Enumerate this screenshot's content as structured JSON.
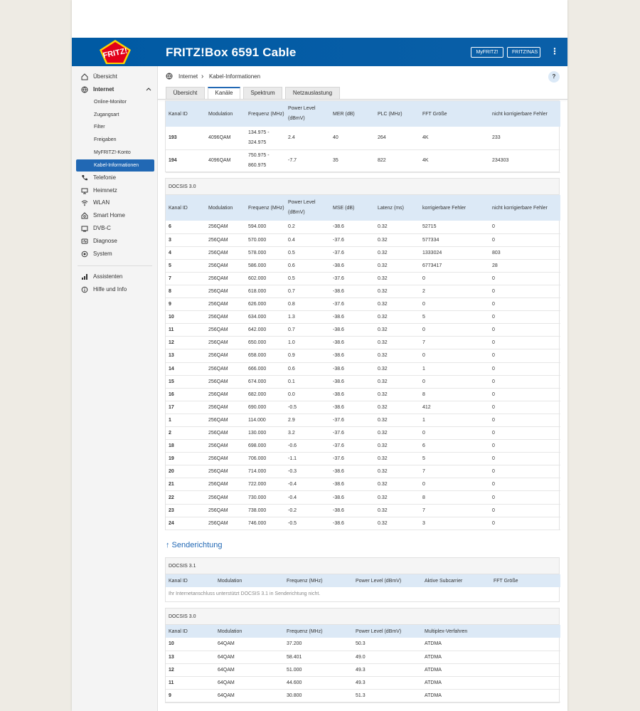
{
  "header": {
    "product": "FRITZ!Box 6591 Cable",
    "logo_text": "FRITZ!",
    "btn_myfritz": "MyFRITZ!",
    "btn_fritznas": "FRITZ!NAS",
    "menu_glyph": "⋮"
  },
  "sidebar": {
    "items": [
      {
        "label": "Übersicht",
        "icon": "home-icon"
      },
      {
        "label": "Internet",
        "icon": "globe-icon"
      },
      {
        "label": "Telefonie",
        "icon": "phone-icon"
      },
      {
        "label": "Heimnetz",
        "icon": "network-icon"
      },
      {
        "label": "WLAN",
        "icon": "wifi-icon"
      },
      {
        "label": "Smart Home",
        "icon": "smarthome-icon"
      },
      {
        "label": "DVB-C",
        "icon": "tv-icon"
      },
      {
        "label": "Diagnose",
        "icon": "diagnose-icon"
      },
      {
        "label": "System",
        "icon": "system-icon"
      },
      {
        "label": "Assistenten",
        "icon": "wizard-icon"
      },
      {
        "label": "Hilfe und Info",
        "icon": "help-icon"
      }
    ],
    "internet_sub": [
      "Online-Monitor",
      "Zugangsart",
      "Filter",
      "Freigaben",
      "MyFRITZ!-Konto",
      "Kabel-Informationen"
    ]
  },
  "breadcrumb": {
    "root": "Internet",
    "sep": "›",
    "current": "Kabel-Informationen"
  },
  "help_label": "?",
  "tabs": [
    "Übersicht",
    "Kanäle",
    "Spektrum",
    "Netzauslastung"
  ],
  "down31": {
    "headers": [
      "Kanal ID",
      "Modulation",
      "Frequenz (MHz)",
      "Power Level (dBmV)",
      "MER (dB)",
      "PLC (MHz)",
      "FFT Größe",
      "nicht korrigierbare Fehler"
    ],
    "rows": [
      [
        "193",
        "4096QAM",
        "134.975 - 324.975",
        "2.4",
        "40",
        "264",
        "4K",
        "233"
      ],
      [
        "194",
        "4096QAM",
        "750.975 - 860.975",
        "-7.7",
        "35",
        "822",
        "4K",
        "234303"
      ]
    ]
  },
  "down30": {
    "title": "DOCSIS 3.0",
    "headers": [
      "Kanal ID",
      "Modulation",
      "Frequenz (MHz)",
      "Power Level (dBmV)",
      "MSE (dB)",
      "Latenz (ms)",
      "korrigierbare Fehler",
      "nicht korrigierbare Fehler"
    ],
    "rows": [
      [
        "6",
        "256QAM",
        "594.000",
        "0.2",
        "-38.6",
        "0.32",
        "52715",
        "0"
      ],
      [
        "3",
        "256QAM",
        "570.000",
        "0.4",
        "-37.6",
        "0.32",
        "577334",
        "0"
      ],
      [
        "4",
        "256QAM",
        "578.000",
        "0.5",
        "-37.6",
        "0.32",
        "1333024",
        "803"
      ],
      [
        "5",
        "256QAM",
        "586.000",
        "0.6",
        "-38.6",
        "0.32",
        "6773417",
        "28"
      ],
      [
        "7",
        "256QAM",
        "602.000",
        "0.5",
        "-37.6",
        "0.32",
        "0",
        "0"
      ],
      [
        "8",
        "256QAM",
        "618.000",
        "0.7",
        "-38.6",
        "0.32",
        "2",
        "0"
      ],
      [
        "9",
        "256QAM",
        "626.000",
        "0.8",
        "-37.6",
        "0.32",
        "0",
        "0"
      ],
      [
        "10",
        "256QAM",
        "634.000",
        "1.3",
        "-38.6",
        "0.32",
        "5",
        "0"
      ],
      [
        "11",
        "256QAM",
        "642.000",
        "0.7",
        "-38.6",
        "0.32",
        "0",
        "0"
      ],
      [
        "12",
        "256QAM",
        "650.000",
        "1.0",
        "-38.6",
        "0.32",
        "7",
        "0"
      ],
      [
        "13",
        "256QAM",
        "658.000",
        "0.9",
        "-38.6",
        "0.32",
        "0",
        "0"
      ],
      [
        "14",
        "256QAM",
        "666.000",
        "0.6",
        "-38.6",
        "0.32",
        "1",
        "0"
      ],
      [
        "15",
        "256QAM",
        "674.000",
        "0.1",
        "-38.6",
        "0.32",
        "0",
        "0"
      ],
      [
        "16",
        "256QAM",
        "682.000",
        "0.0",
        "-38.6",
        "0.32",
        "8",
        "0"
      ],
      [
        "17",
        "256QAM",
        "690.000",
        "-0.5",
        "-38.6",
        "0.32",
        "412",
        "0"
      ],
      [
        "1",
        "256QAM",
        "114.000",
        "2.9",
        "-37.6",
        "0.32",
        "1",
        "0"
      ],
      [
        "2",
        "256QAM",
        "130.000",
        "3.2",
        "-37.6",
        "0.32",
        "0",
        "0"
      ],
      [
        "18",
        "256QAM",
        "698.000",
        "-0.6",
        "-37.6",
        "0.32",
        "6",
        "0"
      ],
      [
        "19",
        "256QAM",
        "706.000",
        "-1.1",
        "-37.6",
        "0.32",
        "5",
        "0"
      ],
      [
        "20",
        "256QAM",
        "714.000",
        "-0.3",
        "-38.6",
        "0.32",
        "7",
        "0"
      ],
      [
        "21",
        "256QAM",
        "722.000",
        "-0.4",
        "-38.6",
        "0.32",
        "0",
        "0"
      ],
      [
        "22",
        "256QAM",
        "730.000",
        "-0.4",
        "-38.6",
        "0.32",
        "8",
        "0"
      ],
      [
        "23",
        "256QAM",
        "738.000",
        "-0.2",
        "-38.6",
        "0.32",
        "7",
        "0"
      ],
      [
        "24",
        "256QAM",
        "746.000",
        "-0.5",
        "-38.6",
        "0.32",
        "3",
        "0"
      ]
    ]
  },
  "upstream_heading": "↑ Senderichtung",
  "up31": {
    "title": "DOCSIS 3.1",
    "headers": [
      "Kanal ID",
      "Modulation",
      "Frequenz (MHz)",
      "Power Level (dBmV)",
      "Aktive Subcarrier",
      "FFT Größe"
    ],
    "note": "Ihr Internetanschluss unterstützt DOCSIS 3.1 in Senderichtung nicht."
  },
  "up30": {
    "title": "DOCSIS 3.0",
    "headers": [
      "Kanal ID",
      "Modulation",
      "Frequenz (MHz)",
      "Power Level (dBmV)",
      "Multiplex-Verfahren"
    ],
    "rows": [
      [
        "10",
        "64QAM",
        "37.200",
        "50.3",
        "ATDMA"
      ],
      [
        "13",
        "64QAM",
        "58.401",
        "49.0",
        "ATDMA"
      ],
      [
        "12",
        "64QAM",
        "51.000",
        "49.3",
        "ATDMA"
      ],
      [
        "11",
        "64QAM",
        "44.600",
        "49.3",
        "ATDMA"
      ],
      [
        "9",
        "64QAM",
        "30.800",
        "51.3",
        "ATDMA"
      ]
    ]
  },
  "colors": {
    "header_blue": "#005aa3",
    "active_blue": "#2168b4",
    "table_header": "#dce9f6",
    "logo_red": "#e2001a",
    "logo_yellow": "#ffd200"
  }
}
